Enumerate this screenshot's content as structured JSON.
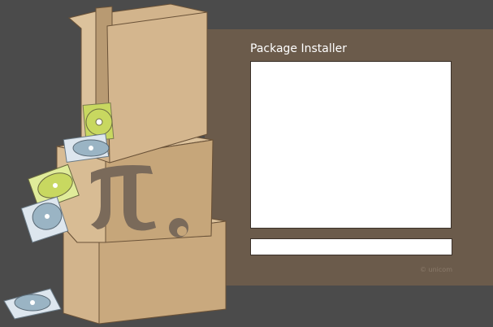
{
  "window": {
    "title": "Package Installer"
  },
  "log": {
    "text": ""
  },
  "progress": {
    "fraction": 0
  },
  "footer": {
    "copyright": "© unicom"
  },
  "colors": {
    "background": "#4b4b4b",
    "panel": "#6b5b4b",
    "box": "#d2b48c",
    "box_shadow": "#b89a72",
    "disc_green": "#c8d860",
    "disc_blue": "#9ab4c4"
  },
  "icons": {
    "illustration": "cardboard-boxes-with-pi-logo",
    "disc": "cd-disc-icon"
  }
}
